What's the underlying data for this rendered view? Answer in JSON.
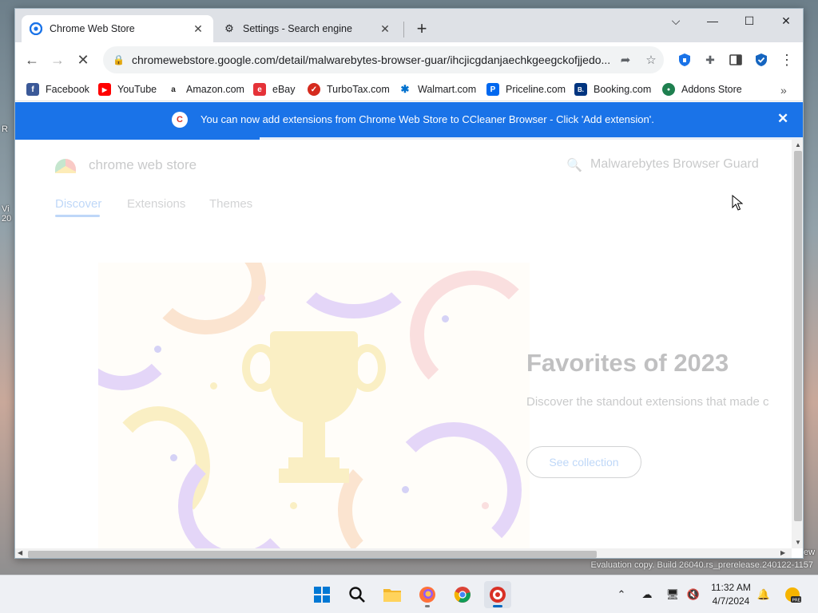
{
  "browser": {
    "tabs": [
      {
        "title": "Chrome Web Store",
        "icon": "chrome-web-store-icon",
        "active": true
      },
      {
        "title": "Settings - Search engine",
        "icon": "gear-icon",
        "active": false
      }
    ],
    "address": {
      "url": "chromewebstore.google.com/detail/malwarebytes-browser-guar/ihcjicgdanjaechkgeegckofjjedo...",
      "loading_progress": 0.31
    },
    "bookmarks": [
      {
        "label": "Facebook",
        "icon": "facebook-icon",
        "color": "#3b5998",
        "glyph": "f"
      },
      {
        "label": "YouTube",
        "icon": "youtube-icon",
        "color": "#ff0000",
        "glyph": "▶"
      },
      {
        "label": "Amazon.com",
        "icon": "amazon-icon",
        "color": "#222222",
        "glyph": "a"
      },
      {
        "label": "eBay",
        "icon": "ebay-icon",
        "color": "#e53238",
        "glyph": "e"
      },
      {
        "label": "TurboTax.com",
        "icon": "turbotax-icon",
        "color": "#d52b1e",
        "glyph": "✓"
      },
      {
        "label": "Walmart.com",
        "icon": "walmart-icon",
        "color": "#0071ce",
        "glyph": "✱"
      },
      {
        "label": "Priceline.com",
        "icon": "priceline-icon",
        "color": "#0068ef",
        "glyph": "P"
      },
      {
        "label": "Booking.com",
        "icon": "booking-icon",
        "color": "#003580",
        "glyph": "B."
      },
      {
        "label": "Addons Store",
        "icon": "addons-store-icon",
        "color": "#1e7f4f",
        "glyph": "●"
      }
    ],
    "infobar": {
      "message": "You can now add extensions from Chrome Web Store to CCleaner Browser - Click 'Add extension'."
    }
  },
  "page": {
    "store_name": "chrome web store",
    "search_text": "Malwarebytes Browser Guard",
    "nav_tabs": [
      "Discover",
      "Extensions",
      "Themes"
    ],
    "active_nav": "Discover",
    "hero": {
      "title": "Favorites of 2023",
      "subtitle": "Discover the standout extensions that made c",
      "button": "See collection"
    }
  },
  "desktop": {
    "watermark": "Evaluation copy. Build 26040.rs_prerelease.240122-1157",
    "fragment_ew": "ew"
  },
  "taskbar": {
    "apps": [
      "start-icon",
      "search-icon",
      "file-explorer-icon",
      "firefox-icon",
      "chrome-icon",
      "ccleaner-browser-icon"
    ],
    "time": "11:32 AM",
    "date": "4/7/2024"
  },
  "colors": {
    "accent": "#1a73e8",
    "tabstrip": "#dee1e6",
    "infobar": "#1a73e8"
  }
}
